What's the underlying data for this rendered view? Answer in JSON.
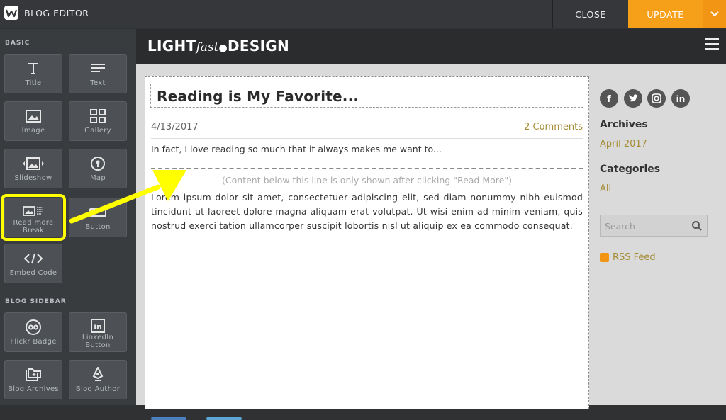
{
  "topbar": {
    "app_title": "BLOG EDITOR",
    "close_label": "CLOSE",
    "update_label": "UPDATE",
    "accent_color": "#f6a01a"
  },
  "sidebar": {
    "basic_label": "BASIC",
    "blog_sidebar_label": "BLOG SIDEBAR",
    "basic_items": [
      {
        "label": "Title",
        "icon": "title-icon"
      },
      {
        "label": "Text",
        "icon": "text-icon"
      },
      {
        "label": "Image",
        "icon": "image-icon"
      },
      {
        "label": "Gallery",
        "icon": "gallery-icon"
      },
      {
        "label": "Slideshow",
        "icon": "slideshow-icon"
      },
      {
        "label": "Map",
        "icon": "map-pin-icon"
      },
      {
        "label": "Read more Break",
        "icon": "read-more-break-icon"
      },
      {
        "label": "Button",
        "icon": "button-icon"
      },
      {
        "label": "Embed Code",
        "icon": "code-icon"
      }
    ],
    "blog_items": [
      {
        "label": "Flickr Badge",
        "icon": "flickr-icon"
      },
      {
        "label": "LinkedIn Button",
        "icon": "linkedin-icon"
      },
      {
        "label": "Blog Archives",
        "icon": "archive-icon"
      },
      {
        "label": "Blog Author",
        "icon": "author-icon"
      }
    ],
    "highlight_color": "#ffff00"
  },
  "site": {
    "brand_left": "LIGHT",
    "brand_mid": "fast",
    "brand_right": "DESIGN"
  },
  "post": {
    "title": "Reading is My Favorite...",
    "date": "4/13/2017",
    "comments": "2 Comments",
    "excerpt": "In fact, I love reading so much that it always makes me want to...",
    "break_note": "(Content below this line is only shown after clicking \"Read More\")",
    "body": "Lorem ipsum dolor sit amet, consectetuer adipiscing elit, sed diam nonummy nibh euismod tincidunt ut laoreet dolore magna aliquam erat volutpat. Ut wisi enim ad minim veniam, quis nostrud exerci tation ullamcorper suscipit lobortis nisl ut aliquip ex ea commodo consequat."
  },
  "blog_sidebar": {
    "social": [
      "facebook-icon",
      "twitter-icon",
      "instagram-icon",
      "linkedin-icon"
    ],
    "archives_heading": "Archives",
    "archives_link": "April 2017",
    "categories_heading": "Categories",
    "categories_link": "All",
    "search_placeholder": "Search",
    "rss_label": "RSS Feed"
  }
}
